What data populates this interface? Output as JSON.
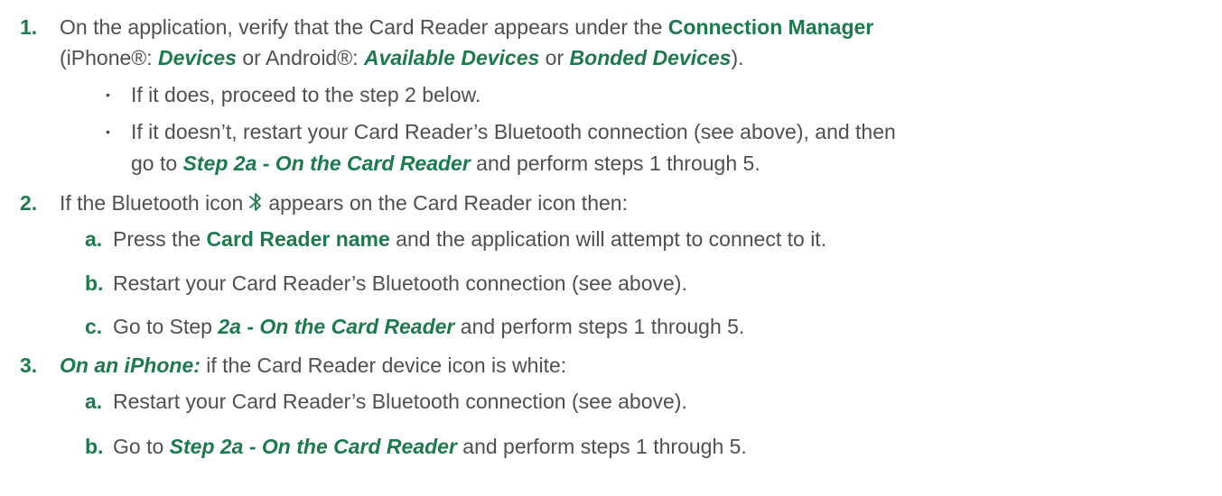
{
  "steps": [
    {
      "number": "1.",
      "line1": {
        "t1": "On the application, verify that the Card Reader appears under the ",
        "b1": "Connection Manager"
      },
      "line2": {
        "t1": "(iPhone®: ",
        "bi1": "Devices",
        "t2": " or Android®: ",
        "bi2": "Available Devices",
        "t3": " or ",
        "bi3": "Bonded Devices",
        "t4": ")."
      },
      "bullets": [
        {
          "text": "If it does, proceed to the step 2 below."
        },
        {
          "line1": "If it doesn’t, restart your Card Reader’s Bluetooth connection (see above), and then",
          "line2": {
            "t1": "go to ",
            "bi1": "Step 2a - On the Card Reader",
            "t2": " and perform steps 1 through 5."
          }
        }
      ]
    },
    {
      "number": "2.",
      "line1": {
        "t1": "If the Bluetooth icon",
        "t2": "appears on the Card Reader icon then:"
      },
      "icon": "bluetooth-icon",
      "substeps": [
        {
          "letter": "a.",
          "t1": "Press the ",
          "b1": "Card Reader name",
          "t2": " and the application will attempt to connect to it."
        },
        {
          "letter": "b.",
          "t1": "Restart your Card Reader’s Bluetooth connection (see above)."
        },
        {
          "letter": "c.",
          "t1": "Go to Step ",
          "bi1": "2a - On the Card Reader",
          "t2": " and perform steps 1 through 5."
        }
      ]
    },
    {
      "number": "3.",
      "line1": {
        "bi1": "On an iPhone:",
        "t1": " if the Card Reader device icon is white:"
      },
      "substeps": [
        {
          "letter": "a.",
          "t1": "Restart your Card Reader’s Bluetooth connection (see above)."
        },
        {
          "letter": "b.",
          "t1": "Go to ",
          "bi1": "Step 2a - On the Card Reader",
          "t2": " and perform steps 1 through 5."
        }
      ]
    }
  ],
  "colors": {
    "accent": "#1c7a4c",
    "text": "#4f4f4f"
  },
  "bullet_glyph": "•"
}
